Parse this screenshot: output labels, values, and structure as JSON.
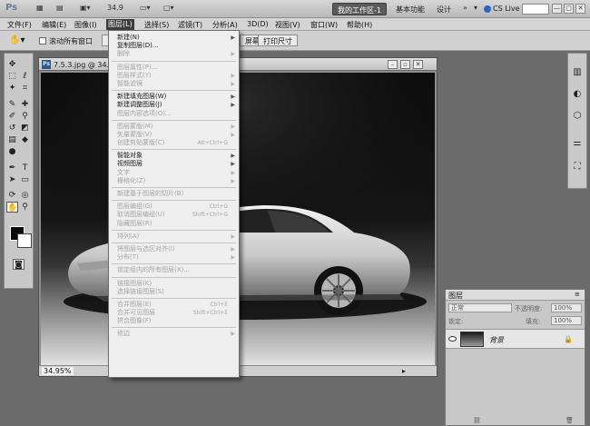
{
  "appbar": {
    "logo": "Ps",
    "zoom_value": "34.9",
    "workspace_active": "我的工作区-1",
    "workspace_links": [
      "基本功能",
      "设计"
    ],
    "cs_live": "CS Live",
    "window_controls": [
      "—",
      "▢",
      "✕"
    ]
  },
  "menubar": {
    "items": [
      {
        "label": "文件(F)"
      },
      {
        "label": "编辑(E)"
      },
      {
        "label": "图像(I)"
      },
      {
        "label": "图层(L)",
        "active": true
      },
      {
        "label": "选择(S)"
      },
      {
        "label": "滤镜(T)"
      },
      {
        "label": "分析(A)"
      },
      {
        "label": "3D(D)"
      },
      {
        "label": "视图(V)"
      },
      {
        "label": "窗口(W)"
      },
      {
        "label": "帮助(H)"
      }
    ]
  },
  "optbar": {
    "checkbox_label": "滚动所有窗口",
    "buttons": [
      "屏幕",
      "打印尺寸"
    ]
  },
  "document": {
    "tab_title": "7.5.3.jpg @ 34.9",
    "zoom_status": "34.95%"
  },
  "layer_menu": {
    "items": [
      {
        "label": "新建(N)",
        "arrow": true,
        "disabled": false
      },
      {
        "label": "复制图层(D)...",
        "disabled": false
      },
      {
        "label": "删除",
        "arrow": true,
        "disabled": true
      },
      {
        "sep": true
      },
      {
        "label": "图层属性(P)...",
        "disabled": true
      },
      {
        "label": "图层样式(Y)",
        "arrow": true,
        "disabled": true
      },
      {
        "label": "智能滤镜",
        "arrow": true,
        "disabled": true
      },
      {
        "sep": true
      },
      {
        "label": "新建填充图层(W)",
        "arrow": true,
        "disabled": false
      },
      {
        "label": "新建调整图层(J)",
        "arrow": true,
        "disabled": false
      },
      {
        "label": "图层内容选项(O)...",
        "disabled": true
      },
      {
        "sep": true
      },
      {
        "label": "图层蒙版(M)",
        "arrow": true,
        "disabled": true
      },
      {
        "label": "矢量蒙版(V)",
        "arrow": true,
        "disabled": true
      },
      {
        "label": "创建剪贴蒙版(C)",
        "shortcut": "Alt+Ctrl+G",
        "disabled": true
      },
      {
        "sep": true
      },
      {
        "label": "智能对象",
        "arrow": true,
        "disabled": false
      },
      {
        "label": "视频图层",
        "arrow": true,
        "disabled": false
      },
      {
        "label": "文字",
        "arrow": true,
        "disabled": true
      },
      {
        "label": "栅格化(Z)",
        "arrow": true,
        "disabled": true
      },
      {
        "sep": true
      },
      {
        "label": "新建基于图层的切片(B)",
        "disabled": true
      },
      {
        "sep": true
      },
      {
        "label": "图层编组(G)",
        "shortcut": "Ctrl+G",
        "disabled": true
      },
      {
        "label": "取消图层编组(U)",
        "shortcut": "Shift+Ctrl+G",
        "disabled": true
      },
      {
        "label": "隐藏图层(R)",
        "disabled": true
      },
      {
        "sep": true
      },
      {
        "label": "排列(A)",
        "arrow": true,
        "disabled": true
      },
      {
        "sep": true
      },
      {
        "label": "将图层与选区对齐(I)",
        "arrow": true,
        "disabled": true
      },
      {
        "label": "分布(T)",
        "arrow": true,
        "disabled": true
      },
      {
        "sep": true
      },
      {
        "label": "锁定组内的所有图层(X)...",
        "disabled": true
      },
      {
        "sep": true
      },
      {
        "label": "链接图层(K)",
        "disabled": true
      },
      {
        "label": "选择链接图层(S)",
        "disabled": true
      },
      {
        "sep": true
      },
      {
        "label": "合并图层(E)",
        "shortcut": "Ctrl+E",
        "disabled": true
      },
      {
        "label": "合并可见图层",
        "shortcut": "Shift+Ctrl+E",
        "disabled": true
      },
      {
        "label": "拼合图像(F)",
        "disabled": true
      },
      {
        "sep": true
      },
      {
        "label": "修边",
        "arrow": true,
        "disabled": true
      }
    ]
  },
  "layers_panel": {
    "tab": "图层",
    "blend_mode": "正常",
    "opacity_label": "不透明度:",
    "opacity_value": "100%",
    "lock_label": "锁定:",
    "fill_label": "填充:",
    "fill_value": "100%",
    "layer_name": "背景"
  },
  "icons": {
    "tools": [
      "move-icon",
      "marquee-icon",
      "lasso-icon",
      "magic-wand-icon",
      "crop-icon",
      "eyedropper-icon",
      "healing-brush-icon",
      "brush-icon",
      "clone-stamp-icon",
      "history-brush-icon",
      "eraser-icon",
      "gradient-icon",
      "blur-icon",
      "dodge-icon",
      "pen-icon",
      "type-icon",
      "path-select-icon",
      "shape-icon",
      "3d-rotate-icon",
      "3d-orbit-icon",
      "hand-icon",
      "zoom-icon",
      "quick-mask-icon"
    ],
    "dock": [
      "histogram-icon",
      "color-icon",
      "navigator-icon",
      "adjustments-icon",
      "transform-icon"
    ]
  }
}
